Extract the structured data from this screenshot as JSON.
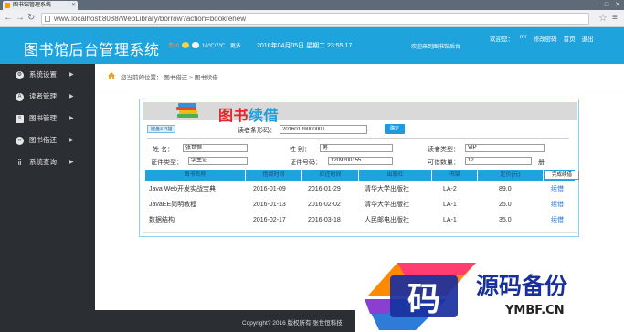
{
  "browser": {
    "tab_title": "图书馆管理系统",
    "url": "www.localhost:8088/WebLibrary/borrow?action=bookrenew",
    "window_controls": [
      "—",
      "□",
      "✕"
    ]
  },
  "header": {
    "title": "图书馆后台管理系统",
    "weather_city": "贵州",
    "weather_temp": "16℃/7℃",
    "weather_more": "更多",
    "datetime": "2016年04月05日 星期二 23:55:17",
    "welcome": "欢迎来到图书馆后台",
    "user_greeting": "欢迎您：",
    "username": "mr",
    "change_password": "修改密码",
    "home": "首页",
    "logout": "退出"
  },
  "sidebar": {
    "items": [
      {
        "label": "系统设置",
        "icon": "gear-icon"
      },
      {
        "label": "读者管理",
        "icon": "reader-icon"
      },
      {
        "label": "图书管理",
        "icon": "books-stack-icon"
      },
      {
        "label": "图书借还",
        "icon": "exchange-icon"
      },
      {
        "label": "系统查询",
        "icon": "query-icon"
      }
    ]
  },
  "breadcrumb": {
    "text": "您当前的位置：  图书借还 > 图书续借"
  },
  "banner": {
    "title_red": "图书",
    "title_blue": "续借"
  },
  "scan": {
    "mode_label": "键盘&扫描",
    "card_label": "读者条形码：",
    "card_value": "20160109000001",
    "confirm_label": "确定"
  },
  "reader": {
    "name_label": "姓    名：",
    "name_value": "张世恒",
    "gender_label": "性    别：",
    "gender_value": "男",
    "type_label": "读者类型：",
    "type_value": "VIP",
    "id_type_label": "证件类型：",
    "id_type_value": "学生证",
    "id_no_label": "证件号码：",
    "id_no_value": "1209200155",
    "quota_label": "可借数量：",
    "quota_value": "12",
    "quota_unit": "册"
  },
  "table": {
    "headers": [
      "图书名称",
      "借阅时间",
      "应还时间",
      "出版社",
      "书架",
      "定价(元)"
    ],
    "done_button": "完成续借",
    "rows": [
      {
        "name": "Java Web开发实战宝典",
        "borrow": "2016-01-09",
        "due": "2016-01-29",
        "publisher": "清华大学出版社",
        "shelf": "LA-2",
        "price": "89.0",
        "action": "续借"
      },
      {
        "name": "JavaEE简明教程",
        "borrow": "2016-01-13",
        "due": "2016-02-02",
        "publisher": "清华大学出版社",
        "shelf": "LA-1",
        "price": "25.0",
        "action": "续借"
      },
      {
        "name": "数据结构",
        "borrow": "2016-02-17",
        "due": "2016-03-18",
        "publisher": "人民邮电出版社",
        "shelf": "LA-1",
        "price": "35.0",
        "action": "续借"
      }
    ]
  },
  "footer": {
    "text": "Copyright? 2016 版权所有 张世恒科技"
  },
  "watermark": {
    "glyph": "码",
    "title": "源码备份",
    "domain": "YMBF.CN"
  },
  "colors": {
    "accent": "#1fa3dd",
    "sidebar": "#2b2e33",
    "title_red": "#e8222c",
    "link": "#1b6fd1"
  }
}
